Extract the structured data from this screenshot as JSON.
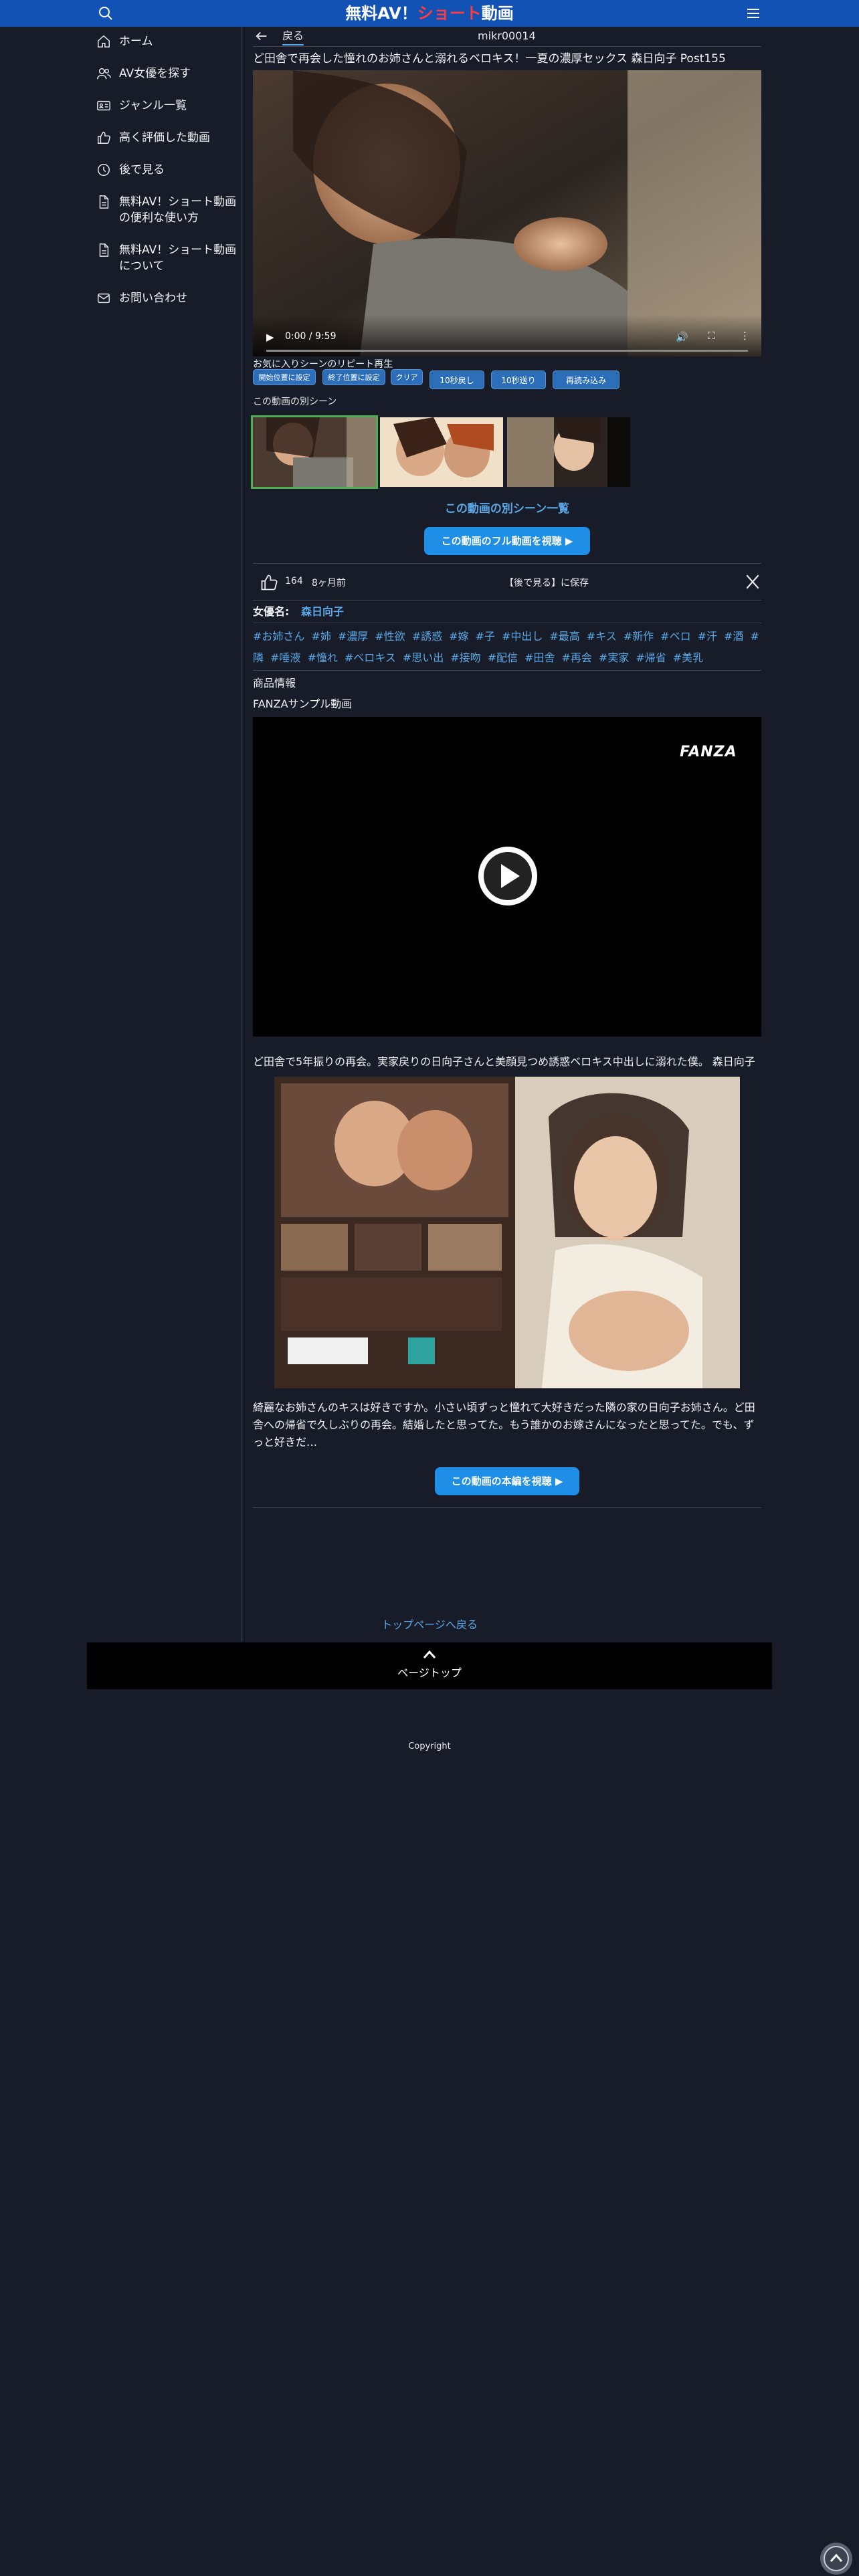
{
  "header": {
    "title_part1": "無料AV！",
    "title_accent": "ショート",
    "title_part2": "動画",
    "accent_color": "#ff3b3b",
    "bg_color": "#1252b5"
  },
  "sidebar": {
    "items": [
      {
        "label": "ホーム",
        "icon": "home-icon"
      },
      {
        "label": "AV女優を探す",
        "icon": "users-icon"
      },
      {
        "label": "ジャンル一覧",
        "icon": "id-card-icon"
      },
      {
        "label": "高く評価した動画",
        "icon": "thumbs-up-icon"
      },
      {
        "label": "後で見る",
        "icon": "clock-icon"
      },
      {
        "label": "無料AV！ショート動画の便利な使い方",
        "icon": "document-icon"
      },
      {
        "label": "無料AV！ショート動画について",
        "icon": "document-icon"
      },
      {
        "label": "お問い合わせ",
        "icon": "mail-icon"
      }
    ]
  },
  "topbar": {
    "back_label": "戻る",
    "post_id": "mikr00014"
  },
  "post": {
    "title": "ど田舎で再会した憧れのお姉さんと溺れるベロキス！一夏の濃厚セックス 森日向子 Post155"
  },
  "player": {
    "time": "0:00 / 9:59"
  },
  "repeat": {
    "label": "お気に入りシーンのリピート再生",
    "buttons": [
      "開始位置に設定",
      "終了位置に設定",
      "クリア",
      "10秒戻し",
      "10秒送り",
      "再読み込み"
    ]
  },
  "scenes": {
    "label": "この動画の別シーン",
    "link": "この動画の別シーン一覧"
  },
  "full_video_button": "この動画のフル動画を視聴 ▶",
  "actions": {
    "like_count": "164",
    "time_ago": "8ヶ月前",
    "save_later": "【後で見る】に保存"
  },
  "actress": {
    "label": "女優名:",
    "name": "森日向子"
  },
  "tags": [
    "#お姉さん",
    "#姉",
    "#濃厚",
    "#性欲",
    "#誘惑",
    "#嫁",
    "#子",
    "#中出し",
    "#最高",
    "#キス",
    "#新作",
    "#ベロ",
    "#汗",
    "#酒",
    "#隣",
    "#唾液",
    "#憧れ",
    "#ベロキス",
    "#思い出",
    "#接吻",
    "#配信",
    "#田舎",
    "#再会",
    "#実家",
    "#帰省",
    "#美乳"
  ],
  "product": {
    "info_label": "商品情報",
    "fanza_label": "FANZAサンプル動画",
    "fanza_logo": "FANZA",
    "short_description": "ど田舎で5年振りの再会。実家戻りの日向子さんと美顔見つめ誘惑ベロキス中出しに溺れた僕。 森日向子",
    "long_description": "綺麗なお姉さんのキスは好きですか。小さい頃ずっと憧れて大好きだった隣の家の日向子お姉さん。ど田舎への帰省で久しぶりの再会。結婚したと思ってた。もう誰かのお嫁さんになったと思ってた。でも、ずっと好きだ…",
    "main_button": "この動画の本編を視聴 ▶"
  },
  "footer": {
    "top_link": "トップページへ戻る",
    "pagetop_label": "ページトップ",
    "copyright": "Copyright"
  }
}
